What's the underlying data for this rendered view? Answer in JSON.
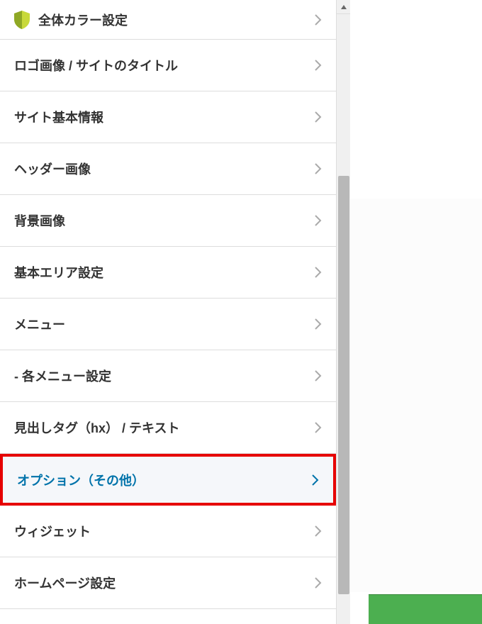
{
  "menu": {
    "items": [
      {
        "label": "全体カラー設定",
        "has_icon": true,
        "highlighted": false
      },
      {
        "label": "ロゴ画像 / サイトのタイトル",
        "has_icon": false,
        "highlighted": false
      },
      {
        "label": "サイト基本情報",
        "has_icon": false,
        "highlighted": false
      },
      {
        "label": "ヘッダー画像",
        "has_icon": false,
        "highlighted": false
      },
      {
        "label": "背景画像",
        "has_icon": false,
        "highlighted": false
      },
      {
        "label": "基本エリア設定",
        "has_icon": false,
        "highlighted": false
      },
      {
        "label": "メニュー",
        "has_icon": false,
        "highlighted": false
      },
      {
        "label": "- 各メニュー設定",
        "has_icon": false,
        "highlighted": false
      },
      {
        "label": "見出しタグ（hx） / テキスト",
        "has_icon": false,
        "highlighted": false
      },
      {
        "label": "オプション（その他）",
        "has_icon": false,
        "highlighted": true
      },
      {
        "label": "ウィジェット",
        "has_icon": false,
        "highlighted": false
      },
      {
        "label": "ホームページ設定",
        "has_icon": false,
        "highlighted": false
      }
    ]
  },
  "colors": {
    "highlight_border": "#e60000",
    "highlight_text": "#0073aa",
    "green_button": "#4caf50"
  }
}
